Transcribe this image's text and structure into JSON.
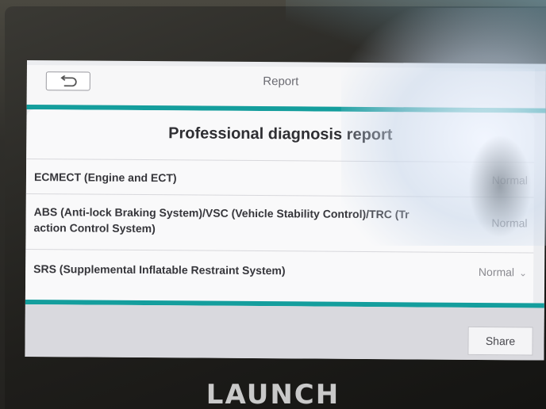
{
  "header": {
    "back_icon": "back-arrow-icon",
    "title": "Report"
  },
  "report": {
    "title": "Professional diagnosis report",
    "rows": [
      {
        "label": "ECMECT (Engine and ECT)",
        "status": "Normal"
      },
      {
        "label_line1": "ABS (Anti-lock Braking System)/VSC (Vehicle Stability Control)/TRC (Tr",
        "label_line2": "action Control System)",
        "status": "Normal"
      },
      {
        "label": "SRS (Supplemental Inflatable Restraint System)",
        "status": "Normal"
      }
    ]
  },
  "footer": {
    "share_label": "Share"
  },
  "device": {
    "brand": "LAUNCH"
  },
  "colors": {
    "accent_teal": "#149e9d"
  }
}
